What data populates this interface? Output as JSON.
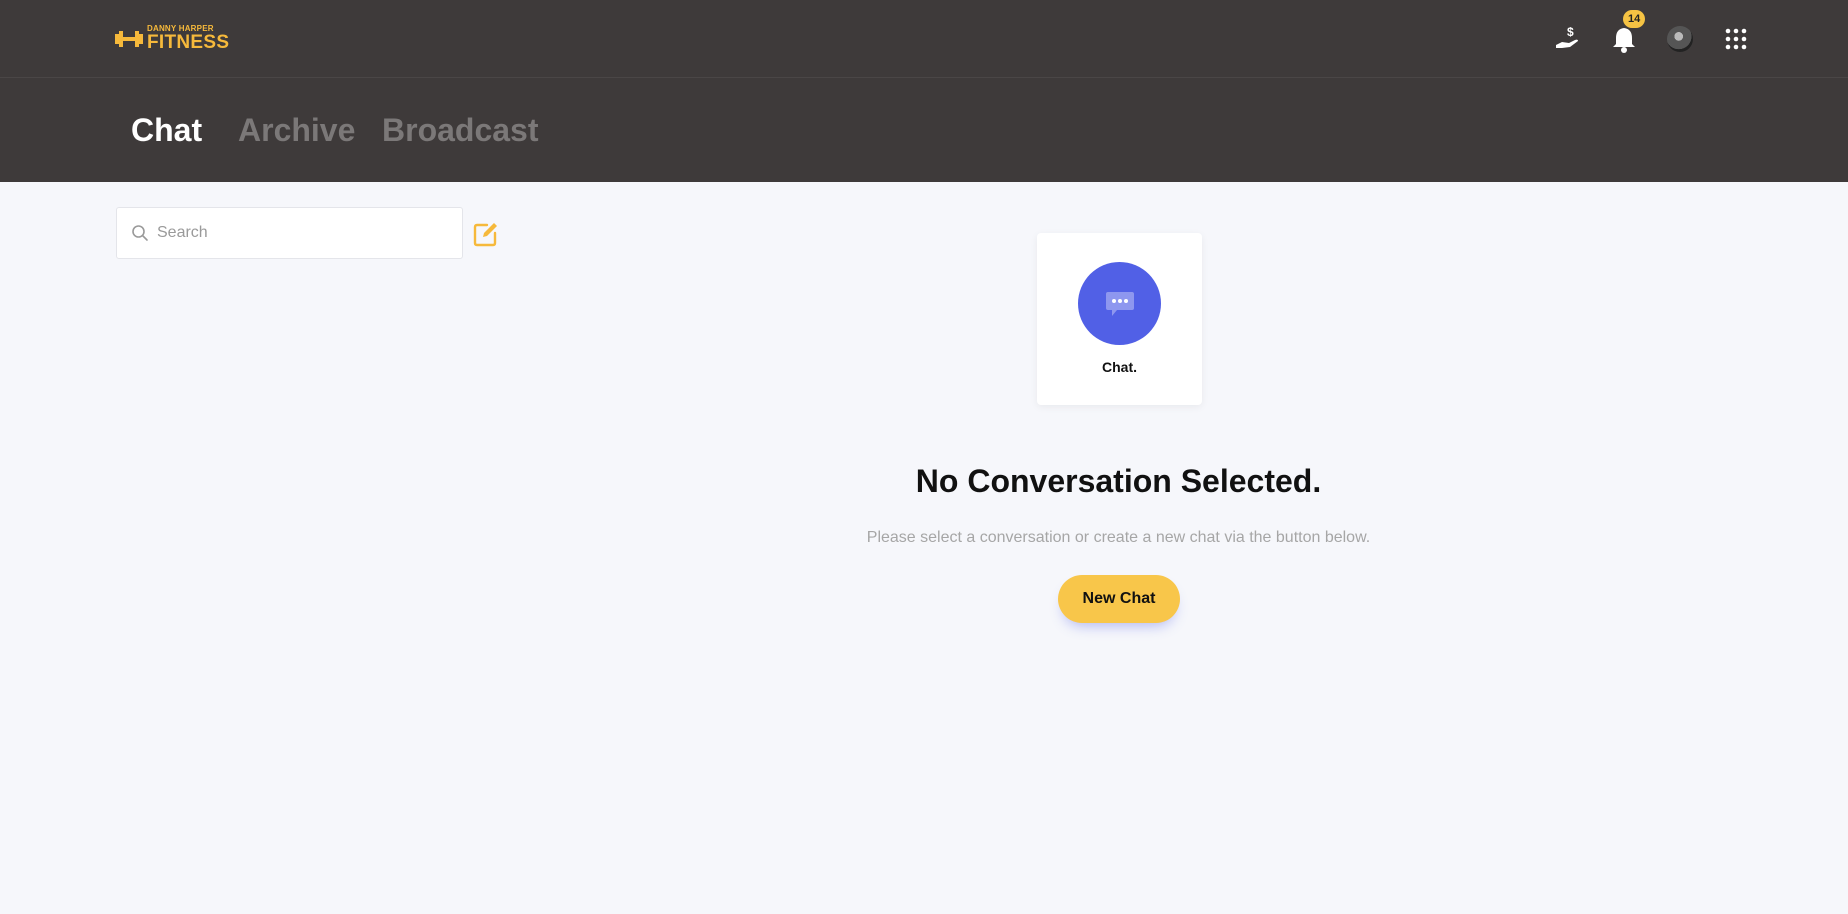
{
  "brand": {
    "line1": "DANNY HARPER",
    "line2": "FITNESS",
    "color": "#f6b93b"
  },
  "topbar": {
    "icons": [
      "payment-hand-icon",
      "bell-icon",
      "avatar",
      "apps-grid-icon"
    ],
    "notification_count": "14"
  },
  "tabs": [
    {
      "label": "Chat",
      "active": true
    },
    {
      "label": "Archive",
      "active": false
    },
    {
      "label": "Broadcast",
      "active": false
    }
  ],
  "search": {
    "placeholder": "Search",
    "value": ""
  },
  "empty_state": {
    "card_label": "Chat.",
    "title": "No Conversation Selected.",
    "subtitle": "Please select a conversation or create a new chat via the button below.",
    "button_label": "New Chat"
  },
  "colors": {
    "header_bg": "#3e3a3a",
    "accent_yellow": "#f8c64a",
    "chat_blue": "#5160e6",
    "page_bg": "#f6f7fb"
  }
}
